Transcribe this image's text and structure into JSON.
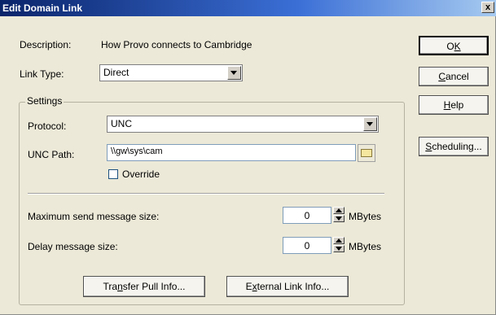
{
  "window": {
    "title": "Edit Domain Link",
    "close_glyph": "x"
  },
  "description": {
    "label": "Description:",
    "value": "How Provo connects to Cambridge"
  },
  "link_type": {
    "label": "Link Type:",
    "value": "Direct"
  },
  "settings": {
    "title": "Settings",
    "protocol": {
      "label": "Protocol:",
      "value": "UNC"
    },
    "unc_path": {
      "label": "UNC Path:",
      "value": "\\\\gw\\sys\\cam"
    },
    "override": {
      "label": "Override",
      "checked": false
    }
  },
  "max_send": {
    "label": "Maximum send message size:",
    "value": "0",
    "unit": "MBytes"
  },
  "delay": {
    "label": "Delay message size:",
    "value": "0",
    "unit": "MBytes"
  },
  "buttons": {
    "ok": {
      "pre": "O",
      "key": "K",
      "post": ""
    },
    "cancel": {
      "pre": "",
      "key": "C",
      "post": "ancel"
    },
    "help": {
      "pre": "",
      "key": "H",
      "post": "elp"
    },
    "scheduling": {
      "pre": "",
      "key": "S",
      "post": "cheduling..."
    },
    "transfer": {
      "pre": "Tra",
      "key": "n",
      "post": "sfer Pull Info..."
    },
    "external": {
      "pre": "E",
      "key": "x",
      "post": "ternal Link Info..."
    }
  }
}
